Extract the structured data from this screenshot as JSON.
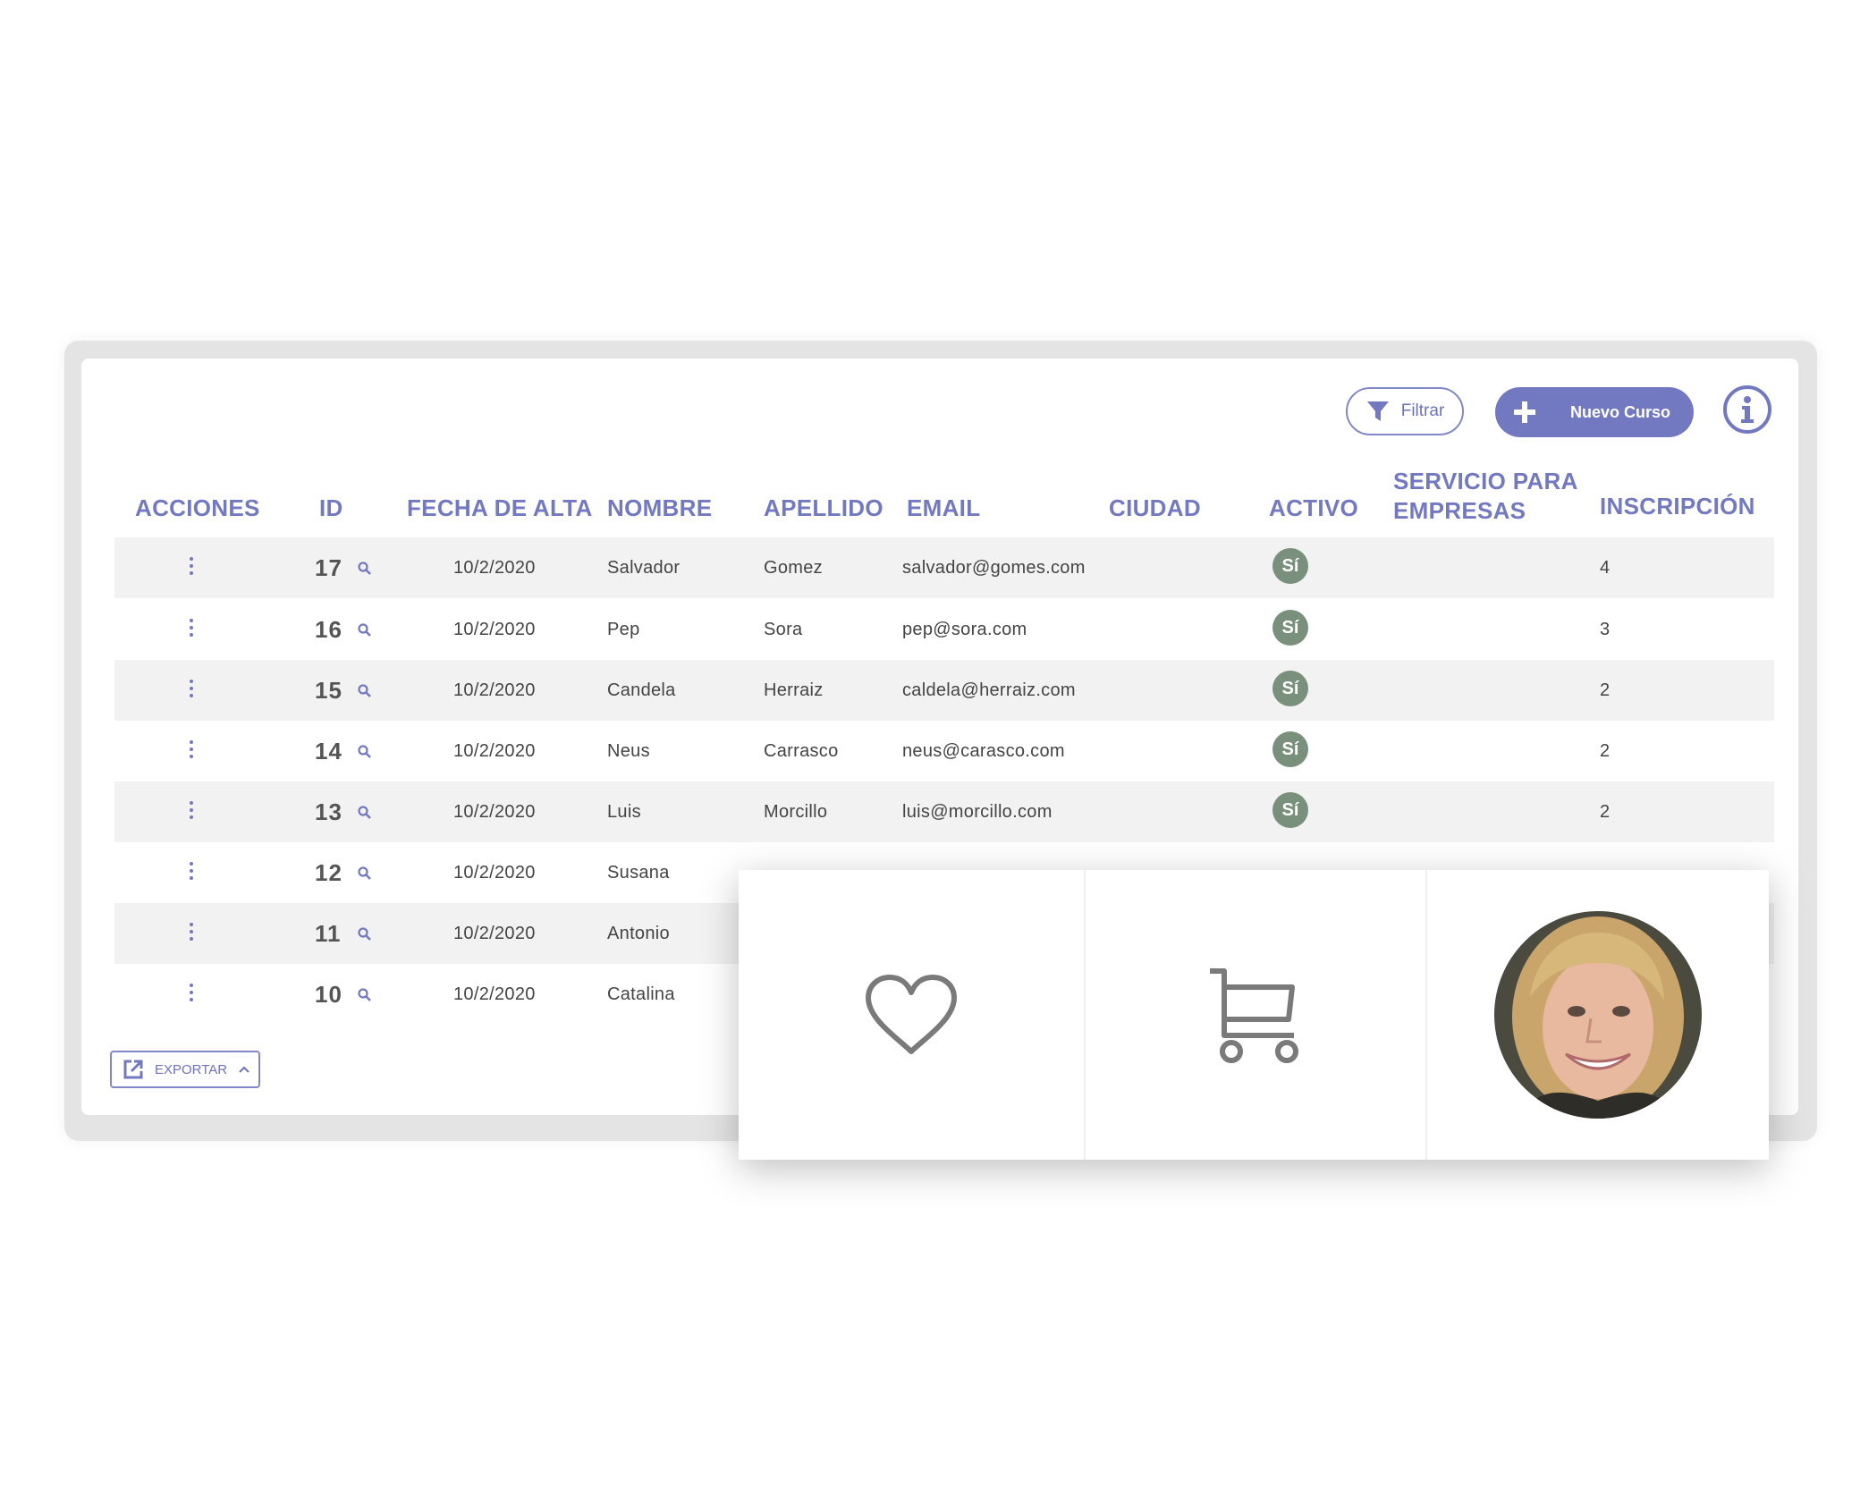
{
  "toolbar": {
    "filter_label": "Filtrar",
    "new_label": "Nuevo Curso"
  },
  "table": {
    "headers": {
      "actions": "ACCIONES",
      "id": "ID",
      "date": "FECHA DE ALTA",
      "name": "NOMBRE",
      "surname": "APELLIDO",
      "email": "EMAIL",
      "city": "CIUDAD",
      "active": "ACTIVO",
      "service_line1": "SERVICIO PARA",
      "service_line2": "EMPRESAS",
      "enrollment": "INSCRIPCIÓN"
    },
    "rows": [
      {
        "id": "17",
        "date": "10/2/2020",
        "name": "Salvador",
        "surname": "Gomez",
        "email": "salvador@gomes.com",
        "active": "Sí",
        "enrollment": "4"
      },
      {
        "id": "16",
        "date": "10/2/2020",
        "name": "Pep",
        "surname": "Sora",
        "email": "pep@sora.com",
        "active": "Sí",
        "enrollment": "3"
      },
      {
        "id": "15",
        "date": "10/2/2020",
        "name": "Candela",
        "surname": "Herraiz",
        "email": "caldela@herraiz.com",
        "active": "Sí",
        "enrollment": "2"
      },
      {
        "id": "14",
        "date": "10/2/2020",
        "name": "Neus",
        "surname": "Carrasco",
        "email": "neus@carasco.com",
        "active": "Sí",
        "enrollment": "2"
      },
      {
        "id": "13",
        "date": "10/2/2020",
        "name": "Luis",
        "surname": "Morcillo",
        "email": "luis@morcillo.com",
        "active": "Sí",
        "enrollment": "2"
      },
      {
        "id": "12",
        "date": "10/2/2020",
        "name": "Susana"
      },
      {
        "id": "11",
        "date": "10/2/2020",
        "name": "Antonio"
      },
      {
        "id": "10",
        "date": "10/2/2020",
        "name": "Catalina"
      }
    ]
  },
  "footer": {
    "export_label": "EXPORTAR"
  },
  "overlay_icons": [
    "heart-icon",
    "cart-icon",
    "avatar-photo"
  ],
  "colors": {
    "accent": "#7279c1",
    "badge": "#78907c",
    "row_shade": "#f2f2f2",
    "frame": "#e4e4e4"
  }
}
